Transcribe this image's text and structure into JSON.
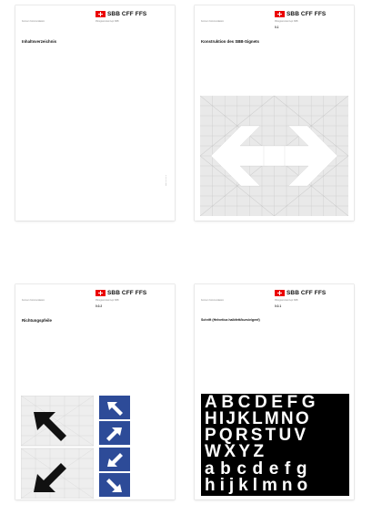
{
  "brand": {
    "name": "SBB CFF FFS",
    "red": "#eb0000",
    "blue": "#2d4b98"
  },
  "pages": [
    {
      "header_left": "Konzern Kommunikation",
      "header_mid": "Piktogrammkonzept SBB",
      "code": "",
      "title": "Inhaltsverzeichnis",
      "side_text": "SBB CFF FFS"
    },
    {
      "header_left": "Konzern Kommunikation",
      "header_mid": "Piktogrammkonzept SBB",
      "code": "0.1",
      "title": "Konstruktion des SBB-Signets",
      "side_text": ""
    },
    {
      "header_left": "Konzern Kommunikation",
      "header_mid": "Piktogrammkonzept SBB",
      "code": "0.0.2",
      "title": "Richtungspfeile",
      "side_text": ""
    },
    {
      "header_left": "Konzern Kommunikation",
      "header_mid": "Piktogrammkonzept SBB",
      "code": "0.0.1",
      "title": "Schrift (Helvetica halbfett/kursiv/genf)",
      "side_text": ""
    }
  ],
  "specimen_lines": [
    "ABCDEFG",
    "HIJKLMNO",
    "PQRSTUV",
    "WXYZ",
    "abcdefg",
    "hijklmno"
  ],
  "arrow_tiles": [
    {
      "name": "arrow-up-left-icon",
      "rotate": -135
    },
    {
      "name": "arrow-up-right-icon",
      "rotate": -45
    },
    {
      "name": "arrow-down-left-icon",
      "rotate": 135
    },
    {
      "name": "arrow-down-right-icon",
      "rotate": 45
    }
  ]
}
